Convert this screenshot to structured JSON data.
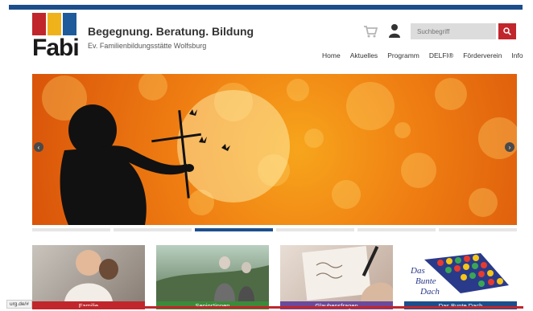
{
  "header": {
    "logo_text": "Fabi",
    "slogan": "Begegnung. Beratung. Bildung",
    "subtitle": "Ev. Familienbildungsstätte Wolfsburg",
    "search_placeholder": "Suchbegriff",
    "icons": {
      "cart": "cart-icon",
      "user": "user-icon",
      "search": "search-icon"
    }
  },
  "nav": {
    "items": [
      "Home",
      "Aktuelles",
      "Programm",
      "DELFI®",
      "Förderverein",
      "Info"
    ]
  },
  "slider": {
    "slide_count": 6,
    "active_index": 2,
    "prev_icon": "chevron-left-icon",
    "next_icon": "chevron-right-icon"
  },
  "cards": [
    {
      "label": "Familie",
      "color": "#c0262c"
    },
    {
      "label": "Senior*innen",
      "color": "#3d8a3a"
    },
    {
      "label": "Glaubensfragen",
      "color": "#6b4a9a"
    },
    {
      "label": "Das Bunte Dach",
      "color": "#1c4e8c",
      "logo_text": [
        "Das",
        "Bunte",
        "Dach"
      ]
    }
  ],
  "status_bar": {
    "url": "urg.de/#"
  },
  "colors": {
    "brand_blue": "#1c4e8c",
    "brand_red": "#c0262c",
    "brand_yellow": "#f0b21a"
  }
}
